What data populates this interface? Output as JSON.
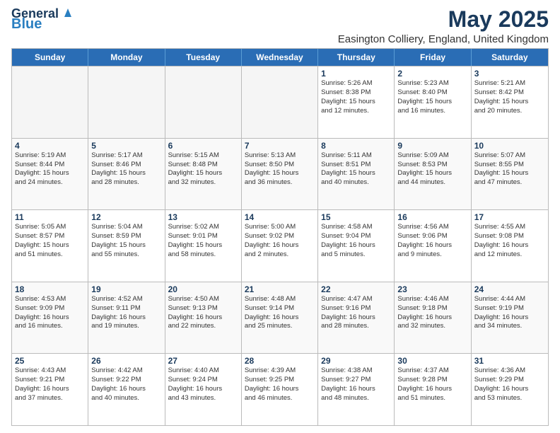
{
  "header": {
    "logo_general": "General",
    "logo_blue": "Blue",
    "month_title": "May 2025",
    "location": "Easington Colliery, England, United Kingdom"
  },
  "weekdays": [
    "Sunday",
    "Monday",
    "Tuesday",
    "Wednesday",
    "Thursday",
    "Friday",
    "Saturday"
  ],
  "weeks": [
    [
      {
        "day": "",
        "text": "",
        "empty": true
      },
      {
        "day": "",
        "text": "",
        "empty": true
      },
      {
        "day": "",
        "text": "",
        "empty": true
      },
      {
        "day": "",
        "text": "",
        "empty": true
      },
      {
        "day": "1",
        "text": "Sunrise: 5:26 AM\nSunset: 8:38 PM\nDaylight: 15 hours\nand 12 minutes.",
        "empty": false
      },
      {
        "day": "2",
        "text": "Sunrise: 5:23 AM\nSunset: 8:40 PM\nDaylight: 15 hours\nand 16 minutes.",
        "empty": false
      },
      {
        "day": "3",
        "text": "Sunrise: 5:21 AM\nSunset: 8:42 PM\nDaylight: 15 hours\nand 20 minutes.",
        "empty": false
      }
    ],
    [
      {
        "day": "4",
        "text": "Sunrise: 5:19 AM\nSunset: 8:44 PM\nDaylight: 15 hours\nand 24 minutes.",
        "empty": false
      },
      {
        "day": "5",
        "text": "Sunrise: 5:17 AM\nSunset: 8:46 PM\nDaylight: 15 hours\nand 28 minutes.",
        "empty": false
      },
      {
        "day": "6",
        "text": "Sunrise: 5:15 AM\nSunset: 8:48 PM\nDaylight: 15 hours\nand 32 minutes.",
        "empty": false
      },
      {
        "day": "7",
        "text": "Sunrise: 5:13 AM\nSunset: 8:50 PM\nDaylight: 15 hours\nand 36 minutes.",
        "empty": false
      },
      {
        "day": "8",
        "text": "Sunrise: 5:11 AM\nSunset: 8:51 PM\nDaylight: 15 hours\nand 40 minutes.",
        "empty": false
      },
      {
        "day": "9",
        "text": "Sunrise: 5:09 AM\nSunset: 8:53 PM\nDaylight: 15 hours\nand 44 minutes.",
        "empty": false
      },
      {
        "day": "10",
        "text": "Sunrise: 5:07 AM\nSunset: 8:55 PM\nDaylight: 15 hours\nand 47 minutes.",
        "empty": false
      }
    ],
    [
      {
        "day": "11",
        "text": "Sunrise: 5:05 AM\nSunset: 8:57 PM\nDaylight: 15 hours\nand 51 minutes.",
        "empty": false
      },
      {
        "day": "12",
        "text": "Sunrise: 5:04 AM\nSunset: 8:59 PM\nDaylight: 15 hours\nand 55 minutes.",
        "empty": false
      },
      {
        "day": "13",
        "text": "Sunrise: 5:02 AM\nSunset: 9:01 PM\nDaylight: 15 hours\nand 58 minutes.",
        "empty": false
      },
      {
        "day": "14",
        "text": "Sunrise: 5:00 AM\nSunset: 9:02 PM\nDaylight: 16 hours\nand 2 minutes.",
        "empty": false
      },
      {
        "day": "15",
        "text": "Sunrise: 4:58 AM\nSunset: 9:04 PM\nDaylight: 16 hours\nand 5 minutes.",
        "empty": false
      },
      {
        "day": "16",
        "text": "Sunrise: 4:56 AM\nSunset: 9:06 PM\nDaylight: 16 hours\nand 9 minutes.",
        "empty": false
      },
      {
        "day": "17",
        "text": "Sunrise: 4:55 AM\nSunset: 9:08 PM\nDaylight: 16 hours\nand 12 minutes.",
        "empty": false
      }
    ],
    [
      {
        "day": "18",
        "text": "Sunrise: 4:53 AM\nSunset: 9:09 PM\nDaylight: 16 hours\nand 16 minutes.",
        "empty": false
      },
      {
        "day": "19",
        "text": "Sunrise: 4:52 AM\nSunset: 9:11 PM\nDaylight: 16 hours\nand 19 minutes.",
        "empty": false
      },
      {
        "day": "20",
        "text": "Sunrise: 4:50 AM\nSunset: 9:13 PM\nDaylight: 16 hours\nand 22 minutes.",
        "empty": false
      },
      {
        "day": "21",
        "text": "Sunrise: 4:48 AM\nSunset: 9:14 PM\nDaylight: 16 hours\nand 25 minutes.",
        "empty": false
      },
      {
        "day": "22",
        "text": "Sunrise: 4:47 AM\nSunset: 9:16 PM\nDaylight: 16 hours\nand 28 minutes.",
        "empty": false
      },
      {
        "day": "23",
        "text": "Sunrise: 4:46 AM\nSunset: 9:18 PM\nDaylight: 16 hours\nand 32 minutes.",
        "empty": false
      },
      {
        "day": "24",
        "text": "Sunrise: 4:44 AM\nSunset: 9:19 PM\nDaylight: 16 hours\nand 34 minutes.",
        "empty": false
      }
    ],
    [
      {
        "day": "25",
        "text": "Sunrise: 4:43 AM\nSunset: 9:21 PM\nDaylight: 16 hours\nand 37 minutes.",
        "empty": false
      },
      {
        "day": "26",
        "text": "Sunrise: 4:42 AM\nSunset: 9:22 PM\nDaylight: 16 hours\nand 40 minutes.",
        "empty": false
      },
      {
        "day": "27",
        "text": "Sunrise: 4:40 AM\nSunset: 9:24 PM\nDaylight: 16 hours\nand 43 minutes.",
        "empty": false
      },
      {
        "day": "28",
        "text": "Sunrise: 4:39 AM\nSunset: 9:25 PM\nDaylight: 16 hours\nand 46 minutes.",
        "empty": false
      },
      {
        "day": "29",
        "text": "Sunrise: 4:38 AM\nSunset: 9:27 PM\nDaylight: 16 hours\nand 48 minutes.",
        "empty": false
      },
      {
        "day": "30",
        "text": "Sunrise: 4:37 AM\nSunset: 9:28 PM\nDaylight: 16 hours\nand 51 minutes.",
        "empty": false
      },
      {
        "day": "31",
        "text": "Sunrise: 4:36 AM\nSunset: 9:29 PM\nDaylight: 16 hours\nand 53 minutes.",
        "empty": false
      }
    ]
  ]
}
